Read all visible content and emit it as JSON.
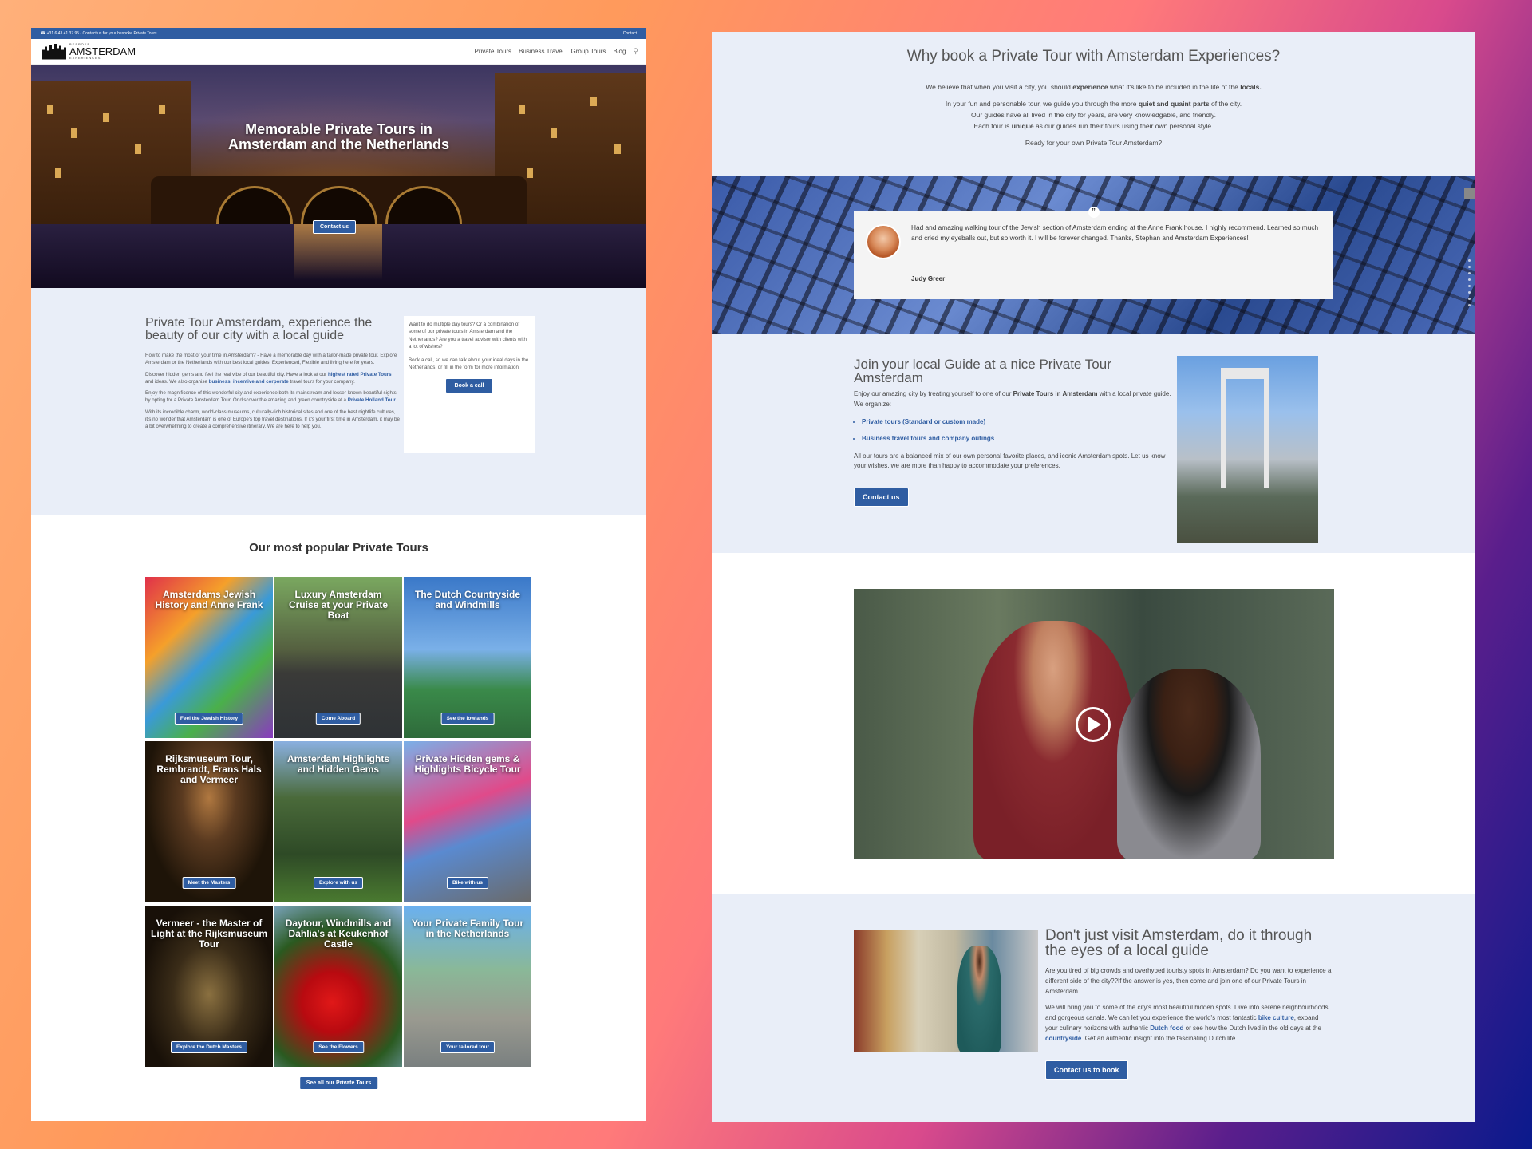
{
  "colors": {
    "primary": "#2f5da2",
    "section_bg": "#e9eef8"
  },
  "topbar": {
    "phone": "☎ +31 6 43 41 37 95 - Contact us for your bespoke Private Tours",
    "contact": "Contact"
  },
  "logo": {
    "small": "BESPOKE",
    "big": "AMSTERDAM",
    "sub": "EXPERIENCES"
  },
  "menu": [
    "Private Tours",
    "Business Travel",
    "Group Tours",
    "Blog"
  ],
  "hero": {
    "title_line1": "Memorable Private Tours in",
    "title_line2": "Amsterdam and the Netherlands",
    "button": "Contact us"
  },
  "intro": {
    "title": "Private Tour Amsterdam, experience the beauty of our city with a local guide",
    "p1": "How to make the most of your time in Amsterdam? - Have a memorable day with a tailor-made private tour. Explore Amsterdam or the Netherlands with our best local guides. Experienced, Flexible and living here for years.",
    "p2a": "Discover hidden gems and feel the real vibe of our beautiful city. Have a look at our ",
    "p2b": "highest rated Private Tours",
    "p2c": " and ideas. We also organise ",
    "p2d": "business, incentive and corporate",
    "p2e": " travel tours for your company.",
    "p3a": "Enjoy the magnificence of this wonderful city and experience both its mainstream and lesser-known beautiful sights by opting for a Private Amsterdam Tour. Or discover the amazing and green countryside at a ",
    "p3b": "Private Holland Tour",
    "p3c": ".",
    "p4": "With its incredible charm, world-class museums, culturally-rich historical sites and one of the best nightlife cultures, it's no wonder that Amsterdam is one of Europe's top travel destinations. If it's your first time in Amsterdam, it may be a bit overwhelming to create a comprehensive itinerary. We are here to help you."
  },
  "intro_card": {
    "p1": "Want to do multiple day tours? Or a combination of some of our private tours in Amsterdam and the Netherlands? Are you a travel advisor with clients with a lot of wishes?",
    "p2": "Book a call, so we can talk about your ideal days in the Netherlands. or fill in the form for more information.",
    "button": "Book a call"
  },
  "popular": {
    "title": "Our most popular Private Tours",
    "tiles": [
      {
        "title": "Amsterdams Jewish History and Anne Frank",
        "button": "Feel the Jewish History"
      },
      {
        "title": "Luxury Amsterdam Cruise at your Private Boat",
        "button": "Come Aboard"
      },
      {
        "title": "The Dutch Countryside and Windmills",
        "button": "See the lowlands"
      },
      {
        "title": "Rijksmuseum Tour, Rembrandt, Frans Hals and Vermeer",
        "button": "Meet the Masters"
      },
      {
        "title": "Amsterdam Highlights and Hidden Gems",
        "button": "Explore with us"
      },
      {
        "title": "Private Hidden gems & Highlights Bicycle Tour",
        "button": "Bike with us"
      },
      {
        "title": "Vermeer - the Master of Light at the Rijksmuseum Tour",
        "button": "Explore the Dutch Masters"
      },
      {
        "title": "Daytour, Windmills and Dahlia's at Keukenhof Castle",
        "button": "See the Flowers"
      },
      {
        "title": "Your Private Family Tour in the Netherlands",
        "button": "Your tailored tour"
      }
    ],
    "see_all": "See all our Private Tours"
  },
  "why": {
    "title": "Why book a Private Tour with Amsterdam Experiences?",
    "p1a": "We believe that when you visit a city, you should ",
    "p1b": "experience",
    "p1c": " what it's like to be included in the life of the ",
    "p1d": "locals.",
    "p2a": "In your fun and personable tour, we guide you through the more ",
    "p2b": "quiet and quaint parts",
    "p2c": " of the city.",
    "p3": "Our guides have all lived in the city for years, are very knowledgable, and friendly.",
    "p4a": "Each tour is ",
    "p4b": "unique",
    "p4c": " as our guides run their tours using their own personal style.",
    "p5": "Ready for your own Private Tour Amsterdam?"
  },
  "testimonial": {
    "text": "Had and amazing walking tour of the Jewish section of Amsterdam ending at the Anne Frank house. I highly recommend. Learned so much and cried my eyeballs out, but so worth it. I will be forever changed. Thanks, Stephan and Amsterdam Experiences!",
    "author": "Judy Greer"
  },
  "join": {
    "title": "Join your local Guide at a nice Private Tour Amsterdam",
    "p1a": "Enjoy our amazing city by treating yourself to one of our ",
    "p1b": "Private Tours in Amsterdam",
    "p1c": " with a local private guide. We organize:",
    "items": [
      "Private tours (Standard or custom made)",
      "Business travel tours and company outings"
    ],
    "p2": "All our tours are a balanced mix of our own personal favorite places, and iconic Amsterdam spots. Let us know your wishes, we are more than happy to accommodate your preferences.",
    "button": "Contact us"
  },
  "local": {
    "title": "Don't just visit Amsterdam, do it through the eyes of a local guide",
    "p1": "Are you tired of big crowds and overhyped touristy spots in Amsterdam? Do you want to experience a different side of the city??If the answer is yes, then come and join one of our Private Tours in Amsterdam.",
    "p2a": "We will bring you to some of the city's most beautiful hidden spots. Dive into serene neighbourhoods and gorgeous canals. We can let you experience the world's most fantastic ",
    "p2b": "bike culture",
    "p2c": ", expand your culinary horizons with authentic ",
    "p2d": "Dutch food",
    "p2e": " or see how the Dutch lived in the old days at the ",
    "p2f": "countryside",
    "p2g": ". Get an authentic insight into the fascinating Dutch life.",
    "button": "Contact us to book"
  }
}
